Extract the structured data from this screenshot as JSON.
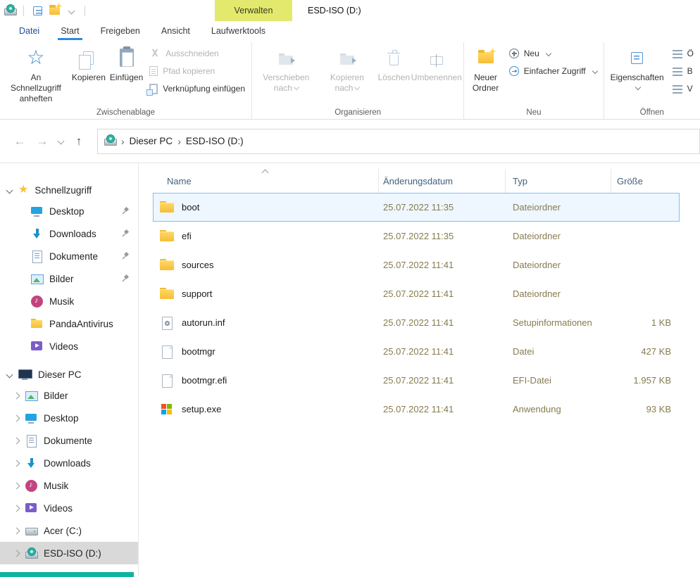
{
  "colors": {
    "manage_tab_bg": "#e3e96d",
    "accent_blue": "#2f8ae0",
    "selection_border": "#7cc0f4",
    "selection_bg": "#eef7ff",
    "sidebar_selected_bg": "#d9d9d9",
    "folder_yellow": "#f6bd37",
    "detail_text": "#867b4f",
    "header_text": "#44607a",
    "teal_strip": "#0fb3a2"
  },
  "titlebar": {
    "manage_label": "Verwalten",
    "title": "ESD-ISO (D:)"
  },
  "menu": {
    "tabs": [
      {
        "label": "Datei",
        "accent": true
      },
      {
        "label": "Start",
        "active": true
      },
      {
        "label": "Freigeben"
      },
      {
        "label": "Ansicht"
      },
      {
        "label": "Laufwerktools"
      }
    ]
  },
  "ribbon": {
    "clipboard": {
      "label": "Zwischenablage",
      "pin_quick": "An Schnellzugriff anheften",
      "copy": "Kopieren",
      "paste": "Einfügen",
      "cut": "Ausschneiden",
      "copy_path": "Pfad kopieren",
      "paste_shortcut": "Verknüpfung einfügen"
    },
    "organize": {
      "label": "Organisieren",
      "move_to": "Verschieben nach",
      "copy_to": "Kopieren nach",
      "delete": "Löschen",
      "rename": "Umbenennen"
    },
    "new": {
      "label": "Neu",
      "new_folder": "Neuer Ordner",
      "new_item": "Neu",
      "easy_access": "Einfacher Zugriff"
    },
    "open": {
      "label": "Öffnen",
      "properties": "Eigenschaften",
      "partial_rows": [
        {
          "label": "Ö"
        },
        {
          "label": "B"
        },
        {
          "label": "V"
        }
      ]
    }
  },
  "navbar": {
    "breadcrumb": [
      {
        "label": "Dieser PC"
      },
      {
        "label": "ESD-ISO (D:)"
      }
    ]
  },
  "sidebar": {
    "quick_access": {
      "label": "Schnellzugriff",
      "items": [
        {
          "label": "Desktop",
          "icon": "desktop",
          "pinned": true
        },
        {
          "label": "Downloads",
          "icon": "downloads",
          "pinned": true
        },
        {
          "label": "Dokumente",
          "icon": "documents",
          "pinned": true
        },
        {
          "label": "Bilder",
          "icon": "pictures",
          "pinned": true
        },
        {
          "label": "Musik",
          "icon": "music",
          "pinned": false
        },
        {
          "label": "PandaAntivirus",
          "icon": "folder",
          "pinned": false
        },
        {
          "label": "Videos",
          "icon": "videos",
          "pinned": false
        }
      ]
    },
    "this_pc": {
      "label": "Dieser PC",
      "items": [
        {
          "label": "Bilder",
          "icon": "pictures"
        },
        {
          "label": "Desktop",
          "icon": "desktop"
        },
        {
          "label": "Dokumente",
          "icon": "documents"
        },
        {
          "label": "Downloads",
          "icon": "downloads"
        },
        {
          "label": "Musik",
          "icon": "music"
        },
        {
          "label": "Videos",
          "icon": "videos"
        },
        {
          "label": "Acer (C:)",
          "icon": "drive"
        },
        {
          "label": "ESD-ISO (D:)",
          "icon": "drive-dvd",
          "selected": true
        }
      ]
    }
  },
  "main": {
    "columns": [
      {
        "label": "Name",
        "sorted": true
      },
      {
        "label": "Änderungsdatum"
      },
      {
        "label": "Typ"
      },
      {
        "label": "Größe"
      }
    ],
    "files": [
      {
        "name": "boot",
        "date": "25.07.2022 11:35",
        "type": "Dateiordner",
        "size": "",
        "icon": "folder",
        "selected": true
      },
      {
        "name": "efi",
        "date": "25.07.2022 11:35",
        "type": "Dateiordner",
        "size": "",
        "icon": "folder"
      },
      {
        "name": "sources",
        "date": "25.07.2022 11:41",
        "type": "Dateiordner",
        "size": "",
        "icon": "folder"
      },
      {
        "name": "support",
        "date": "25.07.2022 11:41",
        "type": "Dateiordner",
        "size": "",
        "icon": "folder"
      },
      {
        "name": "autorun.inf",
        "date": "25.07.2022 11:41",
        "type": "Setupinformationen",
        "size": "1 KB",
        "icon": "inf"
      },
      {
        "name": "bootmgr",
        "date": "25.07.2022 11:41",
        "type": "Datei",
        "size": "427 KB",
        "icon": "file"
      },
      {
        "name": "bootmgr.efi",
        "date": "25.07.2022 11:41",
        "type": "EFI-Datei",
        "size": "1.957 KB",
        "icon": "file"
      },
      {
        "name": "setup.exe",
        "date": "25.07.2022 11:41",
        "type": "Anwendung",
        "size": "93 KB",
        "icon": "app"
      }
    ]
  }
}
